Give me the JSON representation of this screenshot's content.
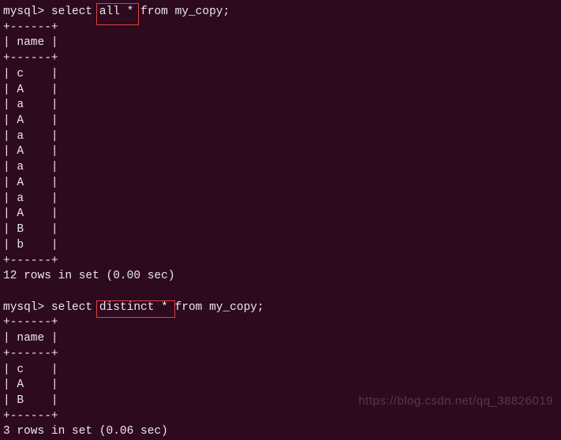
{
  "query1": {
    "prompt": "mysql> ",
    "cmd_pre": "select ",
    "highlighted": "all *",
    "cmd_post": " from my_copy;",
    "divider": "+------+",
    "header": "| name |",
    "rows": [
      "| c    |",
      "| A    |",
      "| a    |",
      "| A    |",
      "| a    |",
      "| A    |",
      "| a    |",
      "| A    |",
      "| a    |",
      "| A    |",
      "| B    |",
      "| b    |"
    ],
    "summary": "12 rows in set (0.00 sec)"
  },
  "query2": {
    "prompt": "mysql> ",
    "cmd_pre": "select ",
    "highlighted": "distinct *",
    "cmd_post": " from my_copy;",
    "divider": "+------+",
    "header": "| name |",
    "rows": [
      "| c    |",
      "| A    |",
      "| B    |"
    ],
    "summary": "3 rows in set (0.06 sec)"
  },
  "watermark": "https://blog.csdn.net/qq_38826019"
}
